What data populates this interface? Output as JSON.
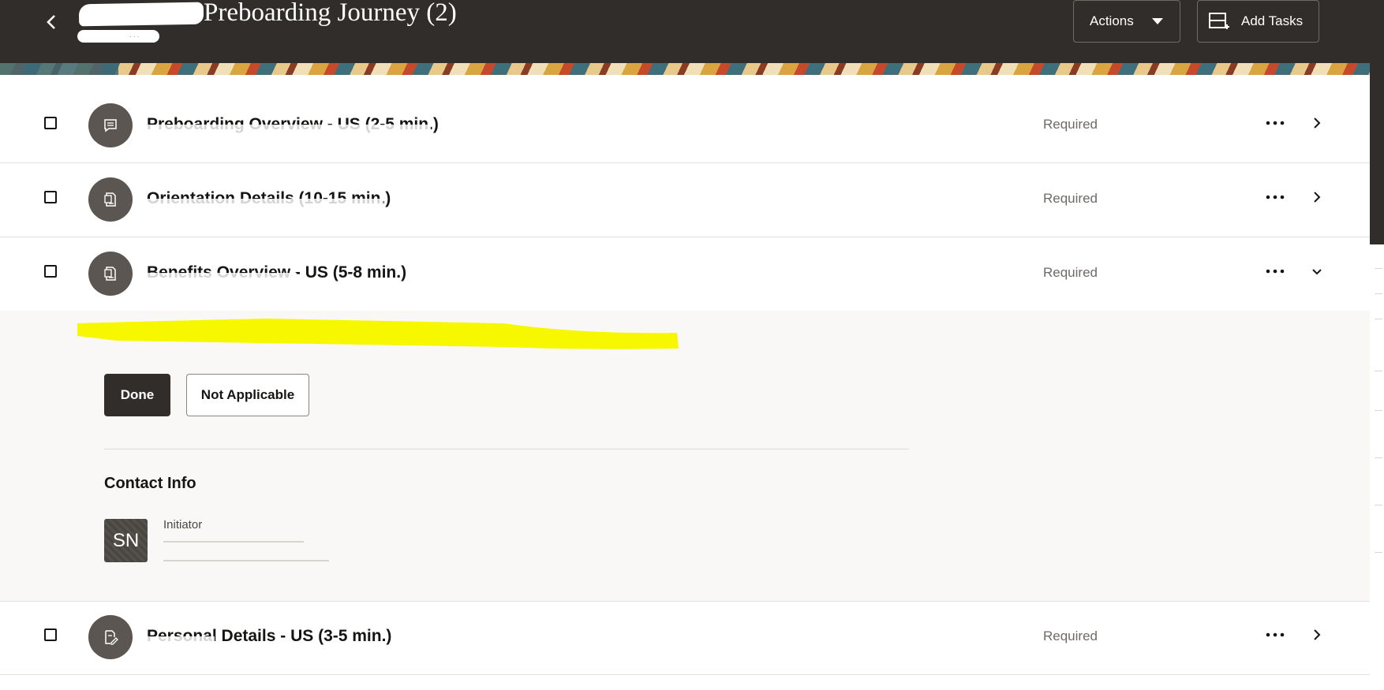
{
  "header": {
    "title": "Preboarding Journey (2)",
    "actions_label": "Actions",
    "add_tasks_label": "Add Tasks"
  },
  "tasks": [
    {
      "title": "Preboarding Overview - US (2-5 min.)",
      "status": "Required",
      "expanded": false,
      "icon": "message-icon"
    },
    {
      "title": "Orientation Details (10-15 min.)",
      "status": "Required",
      "expanded": false,
      "icon": "document-icon"
    },
    {
      "title": "Benefits Overview - US (5-8 min.)",
      "status": "Required",
      "expanded": true,
      "icon": "document-icon"
    },
    {
      "title": "Personal Details - US (3-5 min.)",
      "status": "Required",
      "expanded": false,
      "icon": "edit-document-icon"
    }
  ],
  "detail": {
    "done_label": "Done",
    "not_applicable_label": "Not Applicable",
    "contact_heading": "Contact Info",
    "contact": {
      "initials": "SN",
      "role": "Initiator"
    }
  },
  "colors": {
    "header_bg": "#312d2a",
    "primary_button": "#312d2a",
    "highlight": "#f7f700",
    "detail_bg": "#f9f8f7"
  }
}
